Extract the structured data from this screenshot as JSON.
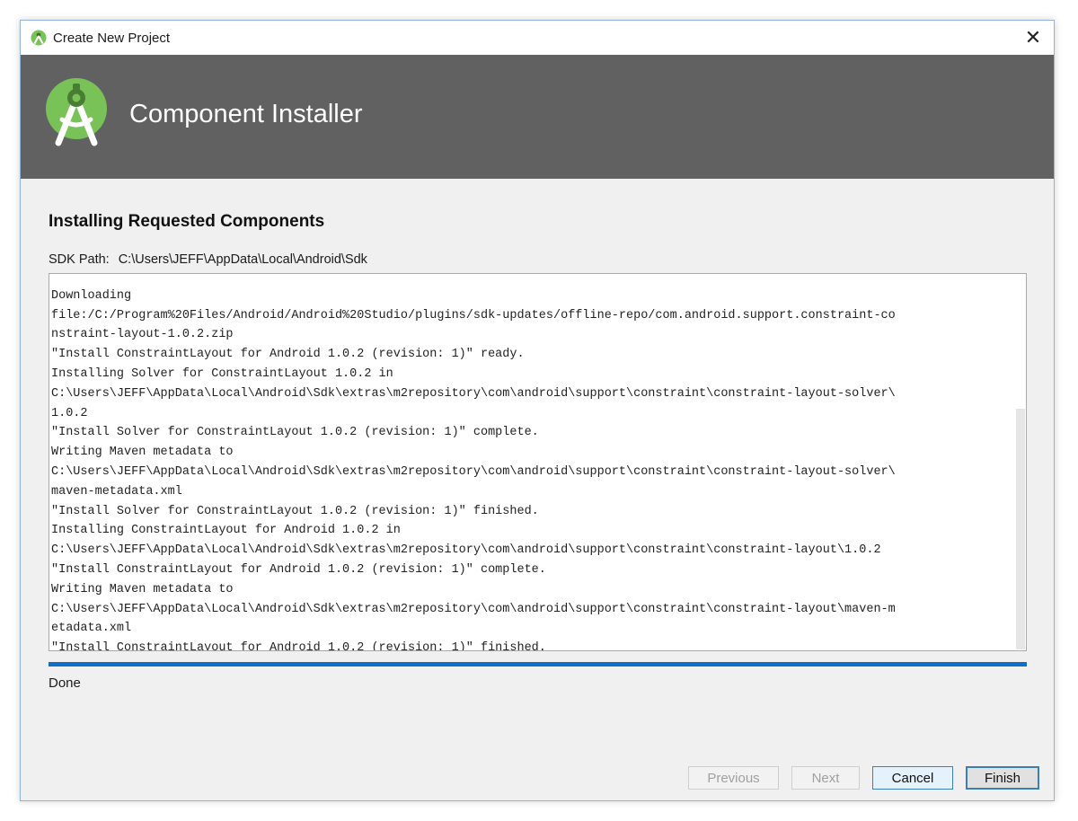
{
  "window": {
    "title": "Create New Project",
    "close_glyph": "✕",
    "icon": "android-studio-icon"
  },
  "banner": {
    "title": "Component Installer",
    "logo": "android-studio-logo",
    "background": "#616161",
    "accent": "#78c257"
  },
  "main": {
    "heading": "Installing Requested Components",
    "sdk_path_label": "SDK Path:",
    "sdk_path_value": "C:\\Users\\JEFF\\AppData\\Local\\Android\\Sdk",
    "log_lines": [
      "",
      "Downloading",
      "file:/C:/Program%20Files/Android/Android%20Studio/plugins/sdk-updates/offline-repo/com.android.support.constraint-co",
      "nstraint-layout-1.0.2.zip",
      "\"Install ConstraintLayout for Android 1.0.2 (revision: 1)\" ready.",
      "Installing Solver for ConstraintLayout 1.0.2 in",
      "C:\\Users\\JEFF\\AppData\\Local\\Android\\Sdk\\extras\\m2repository\\com\\android\\support\\constraint\\constraint-layout-solver\\",
      "1.0.2",
      "\"Install Solver for ConstraintLayout 1.0.2 (revision: 1)\" complete.",
      "Writing Maven metadata to",
      "C:\\Users\\JEFF\\AppData\\Local\\Android\\Sdk\\extras\\m2repository\\com\\android\\support\\constraint\\constraint-layout-solver\\",
      "maven-metadata.xml",
      "\"Install Solver for ConstraintLayout 1.0.2 (revision: 1)\" finished.",
      "Installing ConstraintLayout for Android 1.0.2 in",
      "C:\\Users\\JEFF\\AppData\\Local\\Android\\Sdk\\extras\\m2repository\\com\\android\\support\\constraint\\constraint-layout\\1.0.2",
      "\"Install ConstraintLayout for Android 1.0.2 (revision: 1)\" complete.",
      "Writing Maven metadata to",
      "C:\\Users\\JEFF\\AppData\\Local\\Android\\Sdk\\extras\\m2repository\\com\\android\\support\\constraint\\constraint-layout\\maven-m",
      "etadata.xml",
      "\"Install ConstraintLayout for Android 1.0.2 (revision: 1)\" finished."
    ],
    "progress_percent": 100,
    "progress_color": "#0f6fc6",
    "status": "Done"
  },
  "footer": {
    "previous_label": "Previous",
    "next_label": "Next",
    "cancel_label": "Cancel",
    "finish_label": "Finish"
  }
}
